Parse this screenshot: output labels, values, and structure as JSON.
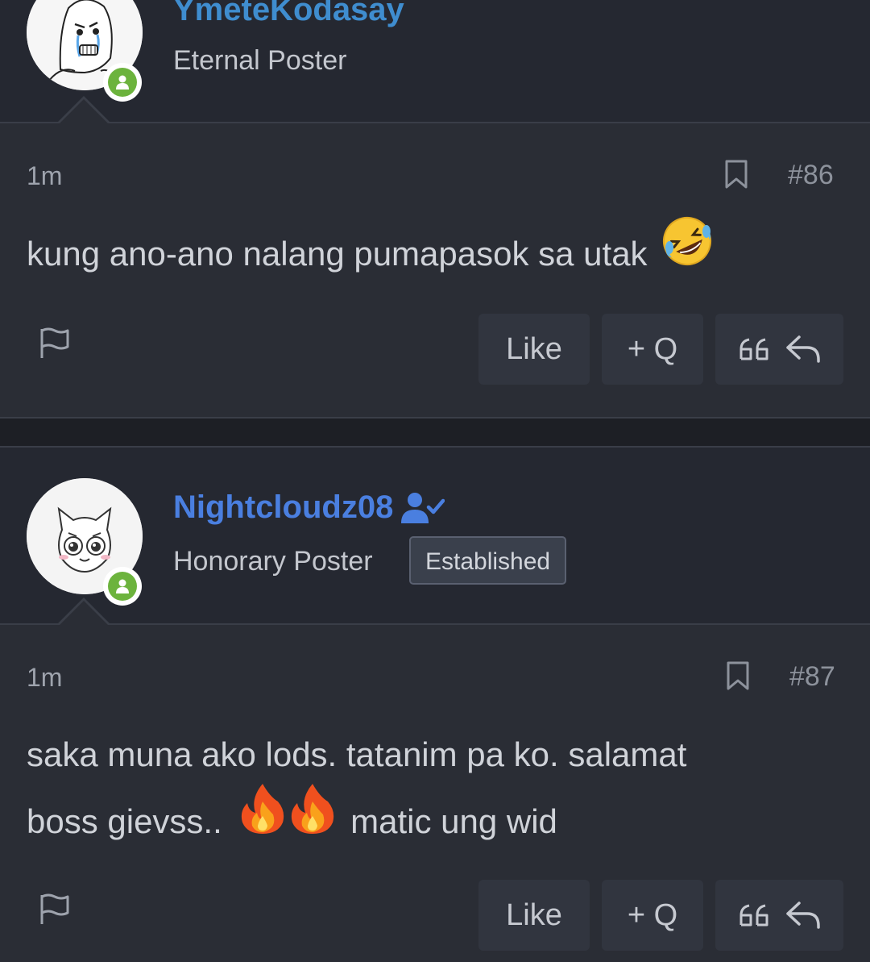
{
  "posts": [
    {
      "username": "YmeteKodasay",
      "user_title": "Eternal Poster",
      "timestamp": "1m",
      "post_number": "#86",
      "body": "kung ano-ano nalang pumapasok sa utak",
      "emoji": "rolling-on-floor-laughing",
      "actions": {
        "like": "Like",
        "quote": "+ Q"
      }
    },
    {
      "username": "Nightcloudz08",
      "user_title": "Honorary Poster",
      "badge": "Established",
      "timestamp": "1m",
      "post_number": "#87",
      "body_line1": "saka muna ako lods. tatanim pa ko. salamat",
      "body_line2_before": "boss gievss..",
      "body_line2_after": "matic ung wid",
      "emojis": [
        "fire",
        "fire"
      ],
      "actions": {
        "like": "Like",
        "quote": "+ Q"
      }
    }
  ],
  "colors": {
    "username": "#4a7fe0",
    "online": "#6cb33d",
    "background": "#2a2d35"
  }
}
